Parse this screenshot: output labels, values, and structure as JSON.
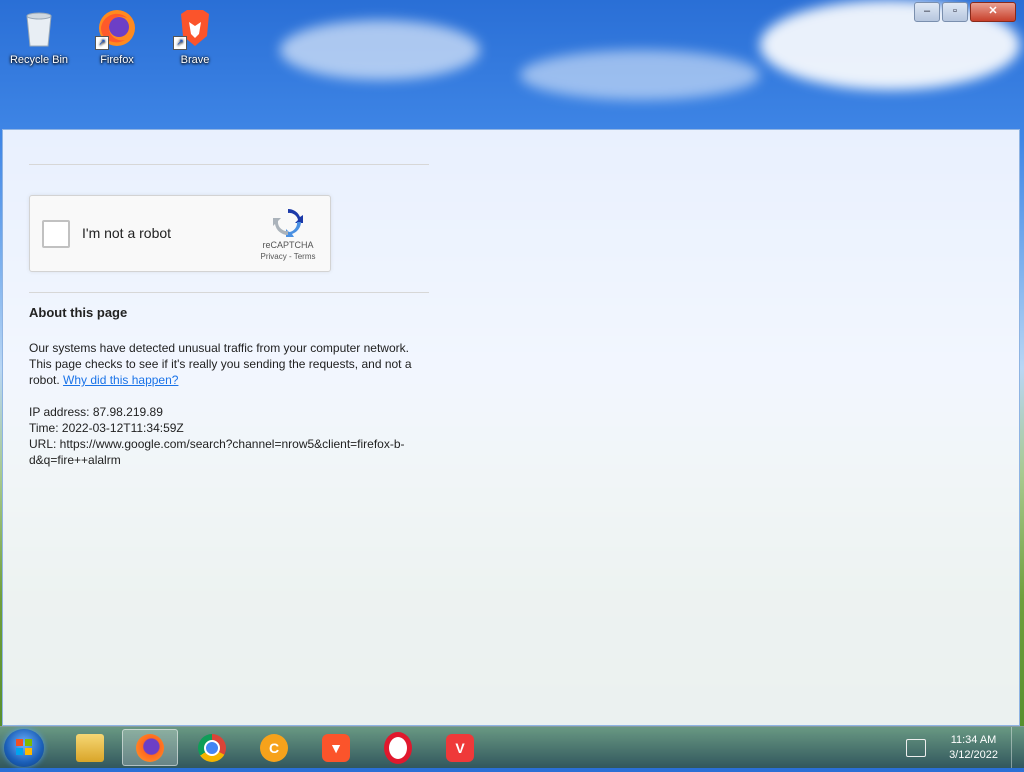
{
  "desktop": {
    "icons": [
      {
        "label": "Recycle Bin"
      },
      {
        "label": "Firefox"
      },
      {
        "label": "Brave"
      }
    ]
  },
  "window": {
    "recaptcha": {
      "checkbox_label": "I'm not a robot",
      "brand": "reCAPTCHA",
      "links": "Privacy - Terms"
    },
    "about_heading": "About this page",
    "message": "Our systems have detected unusual traffic from your computer network. This page checks to see if it's really you sending the requests, and not a robot.",
    "why_link": "Why did this happen?",
    "ip_line": "IP address: 87.98.219.89",
    "time_line": "Time: 2022-03-12T11:34:59Z",
    "url_line": "URL: https://www.google.com/search?channel=nrow5&client=firefox-b-d&q=fire++alalrm"
  },
  "taskbar": {
    "apps": [
      {
        "name": "file-explorer"
      },
      {
        "name": "firefox",
        "active": true
      },
      {
        "name": "chrome"
      },
      {
        "name": "ccleaner"
      },
      {
        "name": "brave"
      },
      {
        "name": "opera"
      },
      {
        "name": "vivaldi"
      }
    ],
    "clock_time": "11:34 AM",
    "clock_date": "3/12/2022"
  },
  "colors": {
    "link": "#1a73e8",
    "recaptcha_blue": "#4a90e2",
    "taskbar": "#2c4a70"
  }
}
